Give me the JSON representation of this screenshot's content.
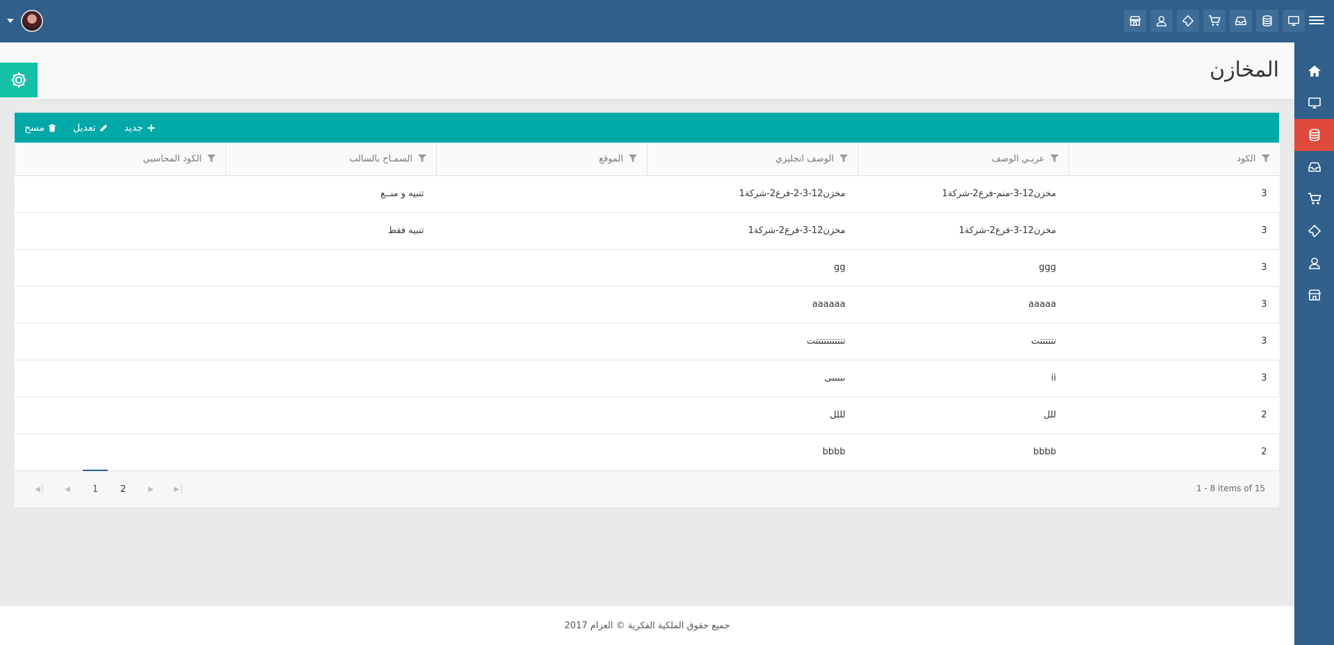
{
  "page": {
    "title": "المخازن"
  },
  "toolbar": {
    "new_label": "جديد",
    "edit_label": "تعديل",
    "delete_label": "مسح"
  },
  "topbar": {
    "icons": [
      "monitor-icon",
      "database-icon",
      "inbox-icon",
      "cart-icon",
      "ticket-icon",
      "user-icon",
      "store-icon"
    ]
  },
  "sidebar": {
    "items": [
      "home-icon",
      "monitor-icon",
      "database-icon",
      "inbox-icon",
      "cart-icon",
      "ticket-icon",
      "user-icon",
      "store-icon"
    ],
    "active": "database-icon"
  },
  "table": {
    "columns": [
      "الكود",
      "عربـي الوصف",
      "الوصف انجليزي",
      "الموقع",
      "السمـاح بالسالب",
      "الكود المحاسبي"
    ],
    "rows": [
      [
        "3",
        "مخزن12-3-منم-فرع2-شركة1",
        "مخزن12-3-2-فرع2-شركة1",
        "",
        "تنبيه و منــع",
        ""
      ],
      [
        "3",
        "مخزن12-3-فرع2-شركة1",
        "مخزن12-3-فرع2-شركة1",
        "",
        "تنبيه فقط",
        ""
      ],
      [
        "3",
        "ggg",
        "gg",
        "",
        "",
        ""
      ],
      [
        "3",
        "aaaaa",
        "aaaaaa",
        "",
        "",
        ""
      ],
      [
        "3",
        "تتتتتتت",
        "تتتتتتتتتتتت",
        "",
        "",
        ""
      ],
      [
        "3",
        "ii",
        "ىىىىىى",
        "",
        "",
        ""
      ],
      [
        "2",
        "للل",
        "لللل",
        "",
        "",
        ""
      ],
      [
        "2",
        "bbbb",
        "bbbb",
        "",
        "",
        ""
      ]
    ]
  },
  "pager": {
    "pages": [
      "1",
      "2"
    ],
    "current": "1",
    "info": "1 - 8 items of 15"
  },
  "footer": {
    "text": "جميع حقوق الملكية الفكرية © العزام 2017"
  },
  "colors": {
    "topbar": "#2f5f8a",
    "accent": "#00a9a8",
    "active_side": "#e04a3d",
    "gear": "#13c0a6"
  }
}
